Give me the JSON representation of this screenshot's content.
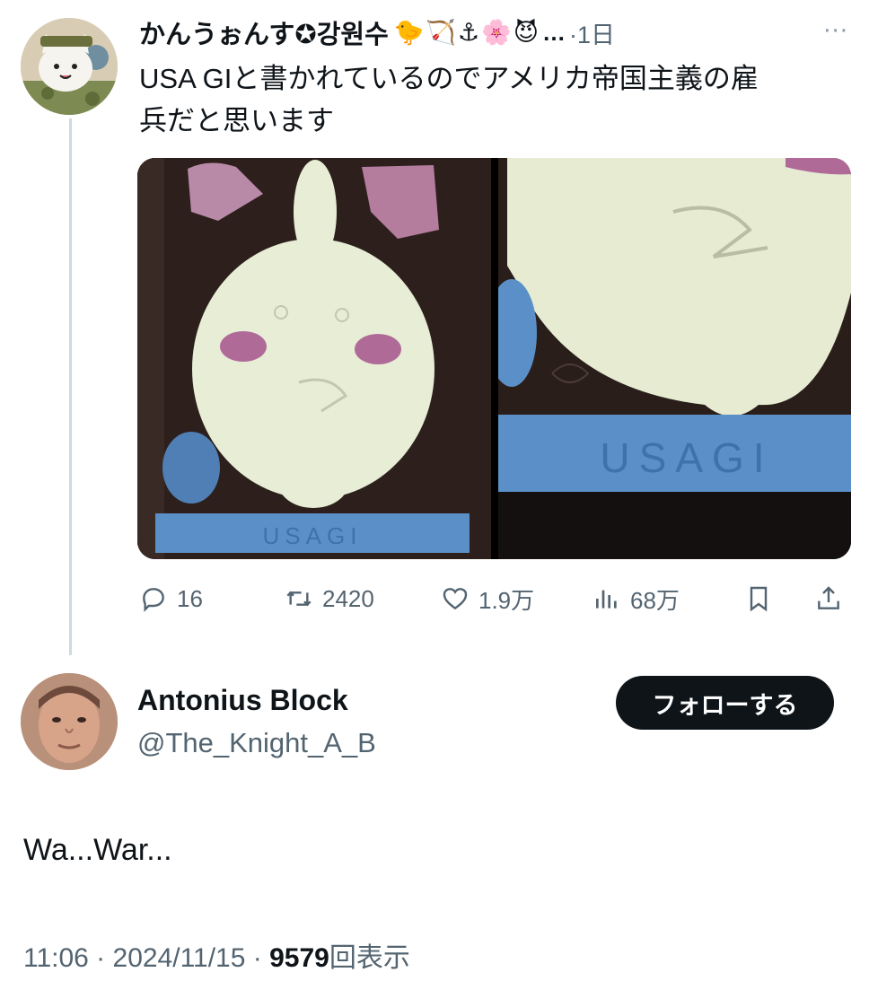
{
  "tweet": {
    "display_name": "かんうぉんす✪강원수",
    "emojis": "🐤🏹⚓🌸😈",
    "ellipsis": "…",
    "time": "·1日",
    "more": "···",
    "text_line1": "USA GIと書かれているのでアメリカ帝国主義の雇",
    "text_line2": "兵だと思います",
    "stats": {
      "replies": "16",
      "retweets": "2420",
      "likes": "1.9万",
      "views": "68万"
    },
    "image_labels": [
      "USAGI",
      "USAGI"
    ]
  },
  "reply": {
    "display_name": "Antonius Block",
    "handle": "@The_Knight_A_B",
    "follow_label": "フォローする",
    "text": "Wa...War...",
    "timestamp": "11:06 · 2024/11/15 · ",
    "views_count": "9579",
    "views_label": "回表示"
  },
  "icons": [
    "more-icon",
    "reply-icon",
    "retweet-icon",
    "like-icon",
    "views-icon",
    "bookmark-icon",
    "share-icon"
  ],
  "colors": {
    "text": "#0f1419",
    "secondary": "#536471",
    "thread_line": "#cfd9de",
    "follow_bg": "#0f1419"
  }
}
